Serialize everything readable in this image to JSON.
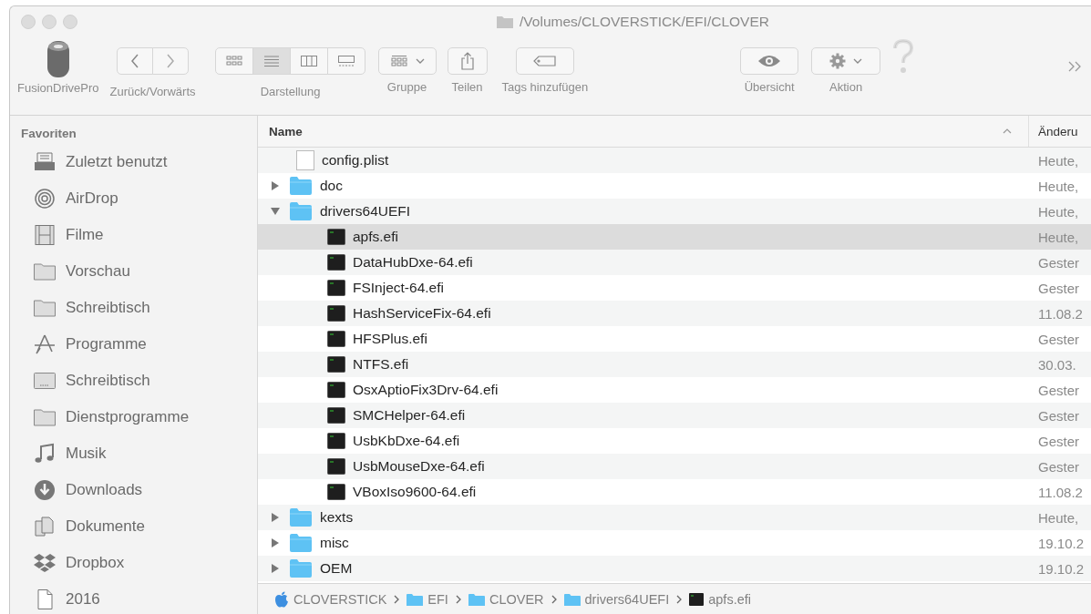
{
  "window": {
    "title": "/Volumes/CLOVERSTICK/EFI/CLOVER"
  },
  "toolbar": [
    {
      "kind": "drive",
      "label": "FusionDrivePro"
    },
    {
      "kind": "nav",
      "label": "Zurück/Vorwärts"
    },
    {
      "kind": "view",
      "label": "Darstellung",
      "options": [
        {
          "kind": "icons",
          "selected": false
        },
        {
          "kind": "list",
          "selected": true
        },
        {
          "kind": "columns",
          "selected": false
        },
        {
          "kind": "gallery",
          "selected": false
        }
      ]
    },
    {
      "kind": "group",
      "label": "Gruppe"
    },
    {
      "kind": "share",
      "label": "Teilen"
    },
    {
      "kind": "tags",
      "label": "Tags hinzufügen"
    },
    {
      "kind": "quicklook",
      "label": "Übersicht"
    },
    {
      "kind": "action",
      "label": "Aktion"
    },
    {
      "kind": "help"
    },
    {
      "kind": "overflow"
    }
  ],
  "sidebar": {
    "heading": "Favoriten",
    "items": [
      {
        "kind": "recents",
        "label": "Zuletzt benutzt"
      },
      {
        "kind": "airdrop",
        "label": "AirDrop"
      },
      {
        "kind": "movies",
        "label": "Filme"
      },
      {
        "kind": "folder",
        "label": "Vorschau"
      },
      {
        "kind": "folder",
        "label": "Schreibtisch"
      },
      {
        "kind": "apps",
        "label": "Programme"
      },
      {
        "kind": "desktop",
        "label": "Schreibtisch"
      },
      {
        "kind": "folder",
        "label": "Dienstprogramme"
      },
      {
        "kind": "music",
        "label": "Musik"
      },
      {
        "kind": "downloads",
        "label": "Downloads"
      },
      {
        "kind": "documents",
        "label": "Dokumente"
      },
      {
        "kind": "dropbox",
        "label": "Dropbox"
      },
      {
        "kind": "document",
        "label": "2016"
      }
    ]
  },
  "table": {
    "columns": [
      {
        "label": "Name",
        "sorted": true
      },
      {
        "label": "Änderu",
        "sorted": false
      }
    ],
    "rows": [
      {
        "kind": "file",
        "name": "config.plist",
        "date": "Heute,",
        "selected": false
      },
      {
        "kind": "folder",
        "name": "doc",
        "date": "Heute,",
        "expanded": false,
        "selected": false
      },
      {
        "kind": "folder",
        "name": "drivers64UEFI",
        "date": "Heute,",
        "expanded": true,
        "selected": false,
        "children": [
          {
            "kind": "efi",
            "name": "apfs.efi",
            "date": "Heute,",
            "selected": true
          },
          {
            "kind": "efi",
            "name": "DataHubDxe-64.efi",
            "date": "Gester",
            "selected": false
          },
          {
            "kind": "efi",
            "name": "FSInject-64.efi",
            "date": "Gester",
            "selected": false
          },
          {
            "kind": "efi",
            "name": "HashServiceFix-64.efi",
            "date": "11.08.2",
            "selected": false
          },
          {
            "kind": "efi",
            "name": "HFSPlus.efi",
            "date": "Gester",
            "selected": false
          },
          {
            "kind": "efi",
            "name": "NTFS.efi",
            "date": "30.03.",
            "selected": false
          },
          {
            "kind": "efi",
            "name": "OsxAptioFix3Drv-64.efi",
            "date": "Gester",
            "selected": false
          },
          {
            "kind": "efi",
            "name": "SMCHelper-64.efi",
            "date": "Gester",
            "selected": false
          },
          {
            "kind": "efi",
            "name": "UsbKbDxe-64.efi",
            "date": "Gester",
            "selected": false
          },
          {
            "kind": "efi",
            "name": "UsbMouseDxe-64.efi",
            "date": "Gester",
            "selected": false
          },
          {
            "kind": "efi",
            "name": "VBoxIso9600-64.efi",
            "date": "11.08.2",
            "selected": false
          }
        ]
      },
      {
        "kind": "folder",
        "name": "kexts",
        "date": "Heute,",
        "expanded": false,
        "selected": false
      },
      {
        "kind": "folder",
        "name": "misc",
        "date": "19.10.2",
        "expanded": false,
        "selected": false
      },
      {
        "kind": "folder",
        "name": "OEM",
        "date": "19.10.2",
        "expanded": false,
        "selected": false
      }
    ]
  },
  "path_bar": [
    {
      "kind": "drive",
      "label": "CLOVERSTICK"
    },
    {
      "kind": "folder",
      "label": "EFI"
    },
    {
      "kind": "folder",
      "label": "CLOVER"
    },
    {
      "kind": "folder",
      "label": "drivers64UEFI"
    },
    {
      "kind": "efi",
      "label": "apfs.efi"
    }
  ]
}
